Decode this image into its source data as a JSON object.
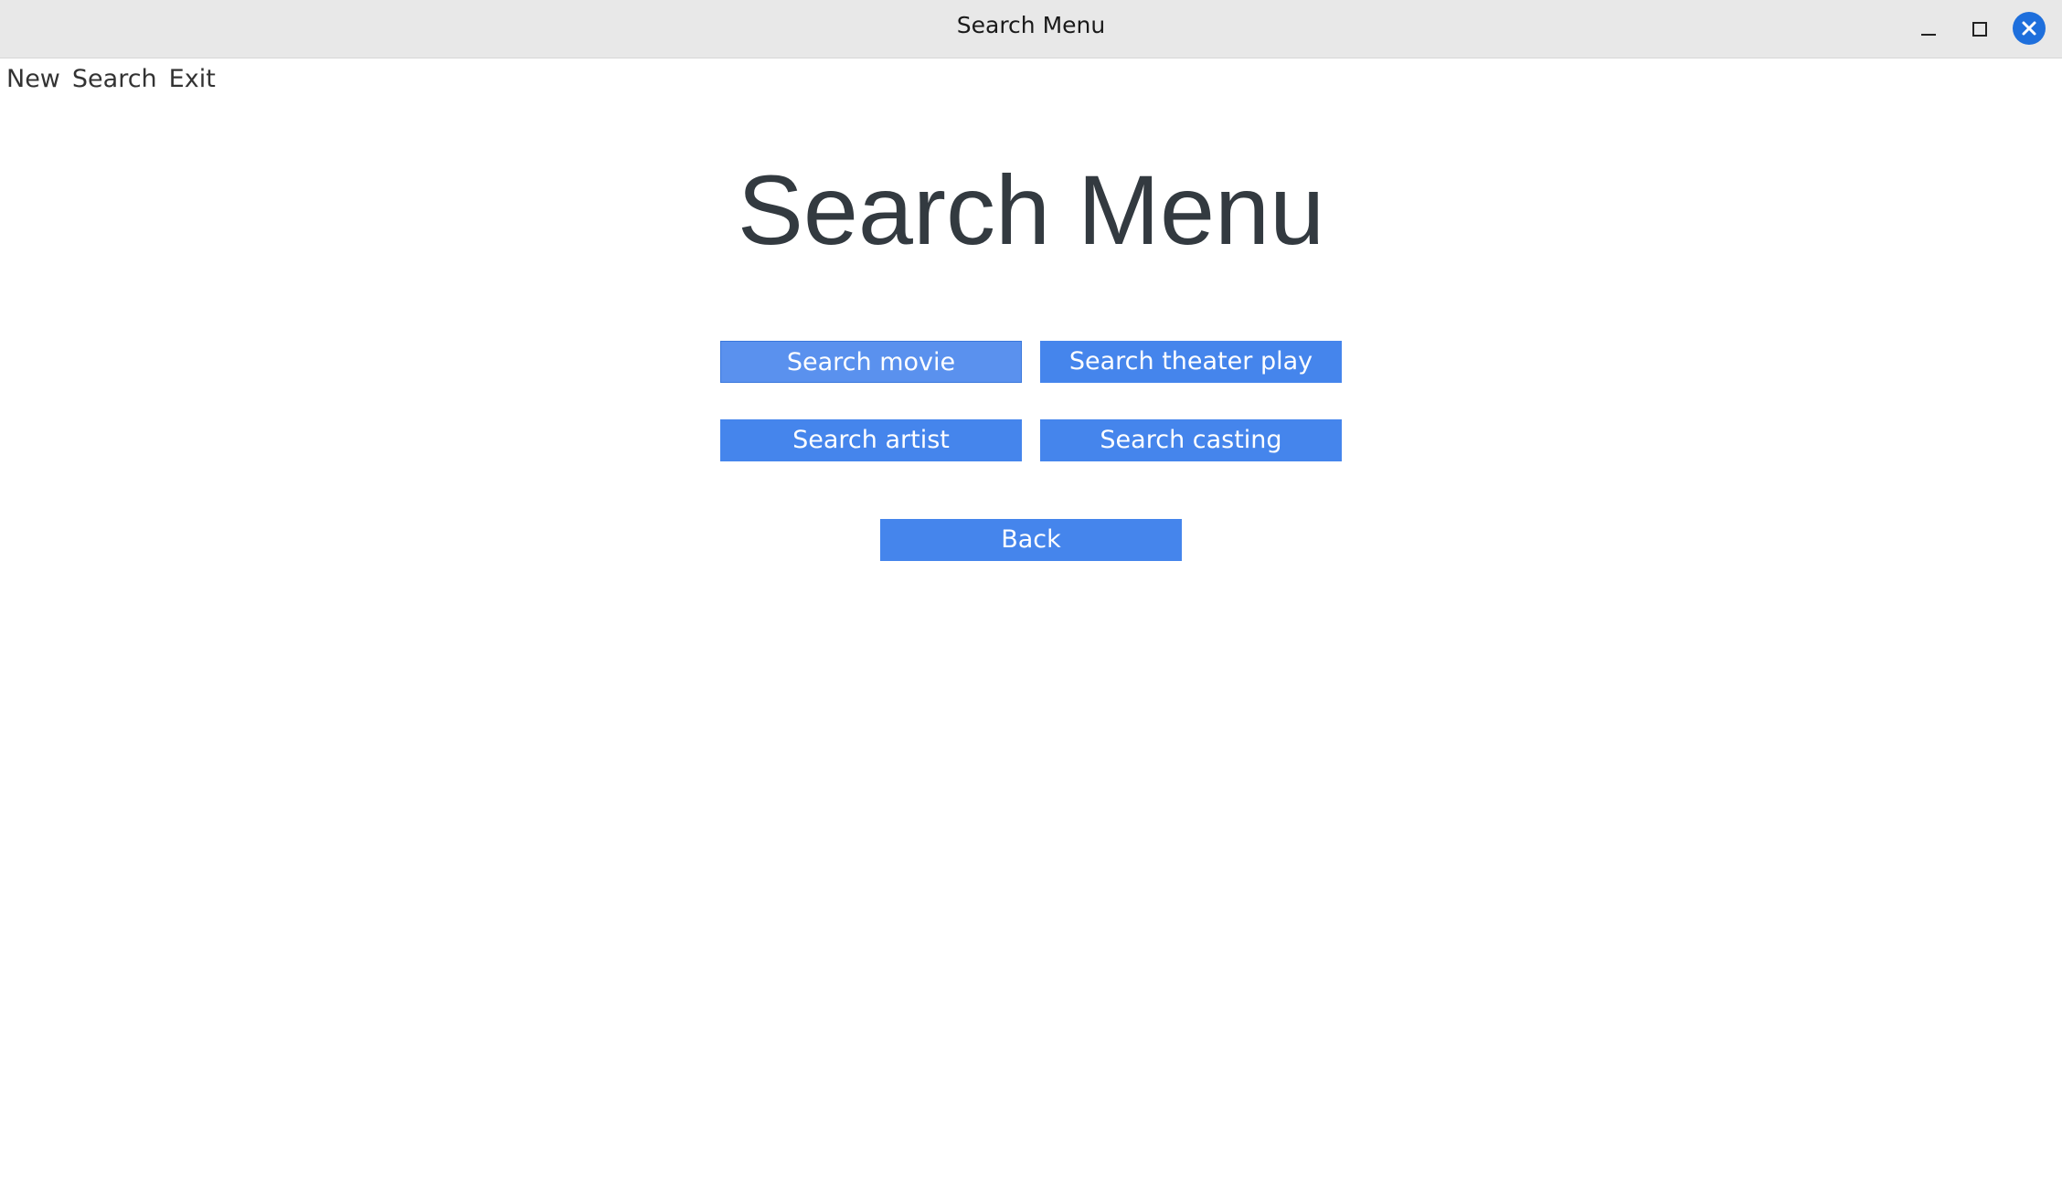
{
  "window": {
    "title": "Search Menu",
    "controls": {
      "minimize_icon": "minimize-icon",
      "maximize_icon": "maximize-icon",
      "close_icon": "close-icon"
    }
  },
  "menubar": {
    "items": [
      {
        "label": "New"
      },
      {
        "label": "Search"
      },
      {
        "label": "Exit"
      }
    ]
  },
  "main": {
    "heading": "Search Menu",
    "buttons": {
      "search_movie": "Search movie",
      "search_theater_play": "Search theater play",
      "search_artist": "Search artist",
      "search_casting": "Search casting",
      "back": "Back"
    }
  },
  "colors": {
    "button_bg": "#4585ec",
    "button_hover_bg": "#5a91ee",
    "close_button": "#1e6fdc",
    "heading_text": "#333a40",
    "titlebar_bg": "#e8e8e8"
  }
}
